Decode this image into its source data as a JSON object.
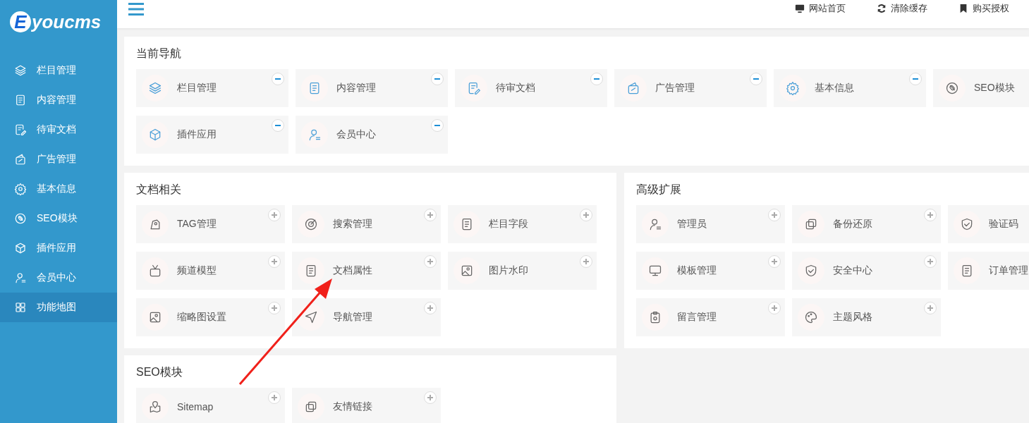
{
  "logo": {
    "letter": "E",
    "text": "youcms"
  },
  "header": {
    "links": [
      {
        "label": "网站首页"
      },
      {
        "label": "清除缓存"
      },
      {
        "label": "购买授权"
      }
    ]
  },
  "sidebar": {
    "items": [
      {
        "label": "栏目管理",
        "selected": false
      },
      {
        "label": "内容管理",
        "selected": false
      },
      {
        "label": "待审文档",
        "selected": false
      },
      {
        "label": "广告管理",
        "selected": false
      },
      {
        "label": "基本信息",
        "selected": false
      },
      {
        "label": "SEO模块",
        "selected": false
      },
      {
        "label": "插件应用",
        "selected": false
      },
      {
        "label": "会员中心",
        "selected": false
      },
      {
        "label": "功能地图",
        "selected": true
      }
    ]
  },
  "panels": [
    {
      "title": "当前导航",
      "items": [
        {
          "label": "栏目管理",
          "added": true
        },
        {
          "label": "内容管理",
          "added": true
        },
        {
          "label": "待审文档",
          "added": true
        },
        {
          "label": "广告管理",
          "added": true
        },
        {
          "label": "基本信息",
          "added": true
        },
        {
          "label": "SEO模块"
        },
        {
          "label": "插件应用",
          "added": true
        },
        {
          "label": "会员中心",
          "added": true
        }
      ]
    },
    {
      "title": "文档相关",
      "items": [
        {
          "label": "TAG管理",
          "added": false
        },
        {
          "label": "搜索管理",
          "added": false
        },
        {
          "label": "栏目字段",
          "added": false
        },
        {
          "label": "频道模型",
          "added": false
        },
        {
          "label": "文档属性",
          "added": false
        },
        {
          "label": "图片水印",
          "added": false
        },
        {
          "label": "缩略图设置",
          "added": false
        },
        {
          "label": "导航管理",
          "added": false
        }
      ]
    },
    {
      "title": "高级扩展",
      "items": [
        {
          "label": "管理员",
          "added": false
        },
        {
          "label": "备份还原",
          "added": false
        },
        {
          "label": "验证码"
        },
        {
          "label": "模板管理",
          "added": false
        },
        {
          "label": "安全中心",
          "added": false
        },
        {
          "label": "订单管理"
        },
        {
          "label": "留言管理",
          "added": false
        },
        {
          "label": "主题风格",
          "added": false
        }
      ]
    },
    {
      "title": "SEO模块",
      "items": [
        {
          "label": "Sitemap",
          "added": false
        },
        {
          "label": "友情链接",
          "added": false
        }
      ]
    }
  ]
}
